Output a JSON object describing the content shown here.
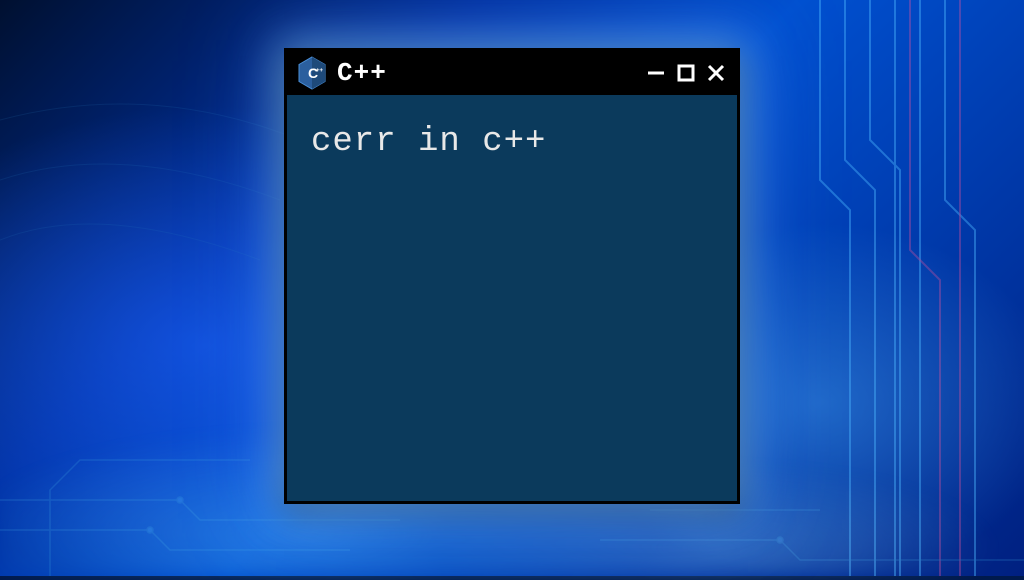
{
  "window": {
    "title": "C++",
    "content": "cerr in c++"
  },
  "icons": {
    "logo": "cpp-hexagon",
    "minimize": "minimize",
    "maximize": "maximize",
    "close": "close"
  }
}
